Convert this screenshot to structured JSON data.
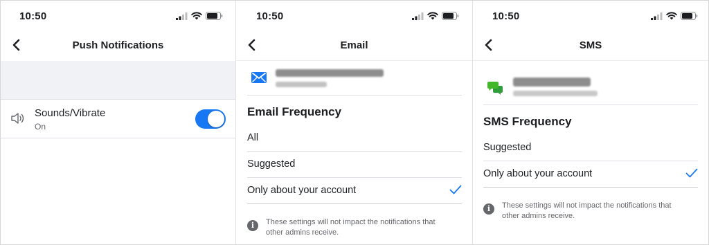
{
  "status": {
    "time": "10:50"
  },
  "panels": {
    "push": {
      "title": "Push Notifications",
      "item": {
        "label": "Sounds/Vibrate",
        "sub": "On",
        "toggle_on": true
      }
    },
    "email": {
      "title": "Email",
      "section": "Email Frequency",
      "options": [
        "All",
        "Suggested",
        "Only about your account"
      ],
      "selected": "Only about your account",
      "note_line1": "These settings will not impact the notifications that",
      "note_line2": "other admins receive."
    },
    "sms": {
      "title": "SMS",
      "section": "SMS Frequency",
      "options": [
        "Suggested",
        "Only about your account"
      ],
      "selected": "Only about your account",
      "note_line1": "These settings will not impact the notifications that",
      "note_line2": "other admins receive."
    }
  },
  "colors": {
    "accent": "#1877f2",
    "sms_icon": "#42b72a",
    "band": "#f0f2f5",
    "secondary_text": "#65676b"
  },
  "icons": [
    "cellular-signal-icon",
    "wifi-icon",
    "battery-icon",
    "back-chevron-icon",
    "speaker-icon",
    "mail-icon",
    "chat-bubbles-icon",
    "checkmark-icon",
    "info-icon"
  ]
}
